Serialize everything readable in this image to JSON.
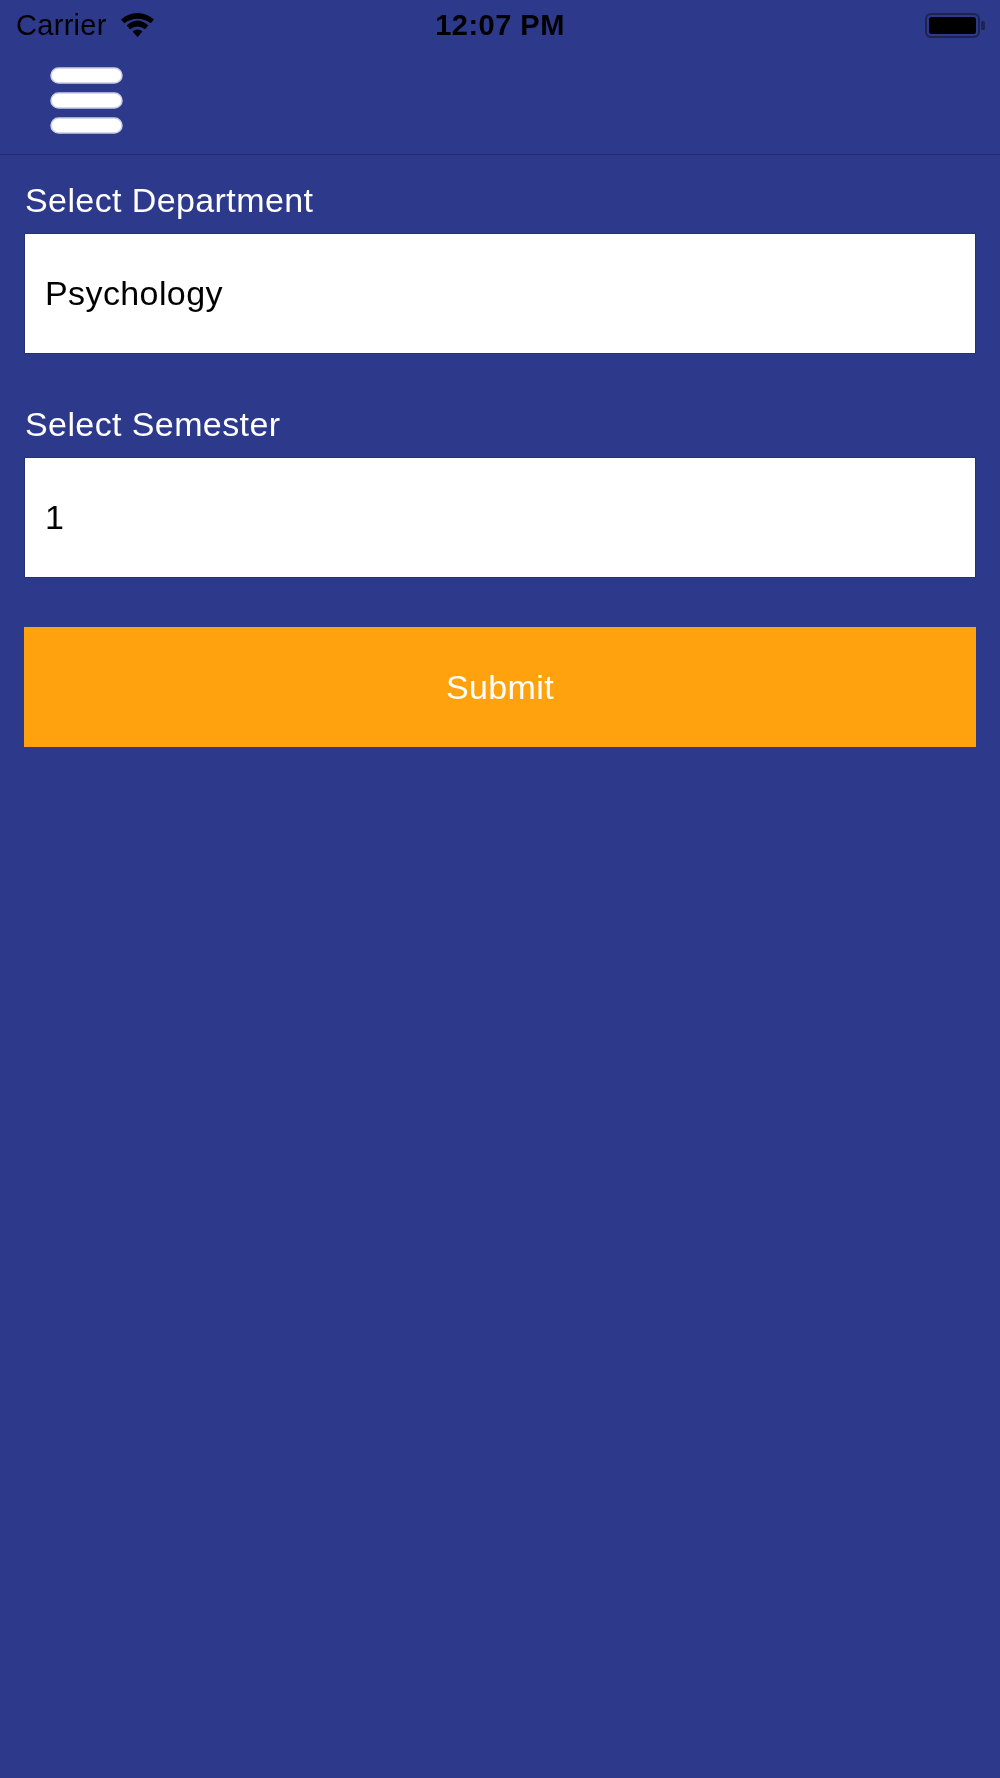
{
  "status_bar": {
    "carrier": "Carrier",
    "time": "12:07 PM"
  },
  "form": {
    "fields": [
      {
        "label": "Select Department",
        "value": "Psychology"
      },
      {
        "label": "Select Semester",
        "value": "1"
      }
    ],
    "submit": "Submit"
  }
}
